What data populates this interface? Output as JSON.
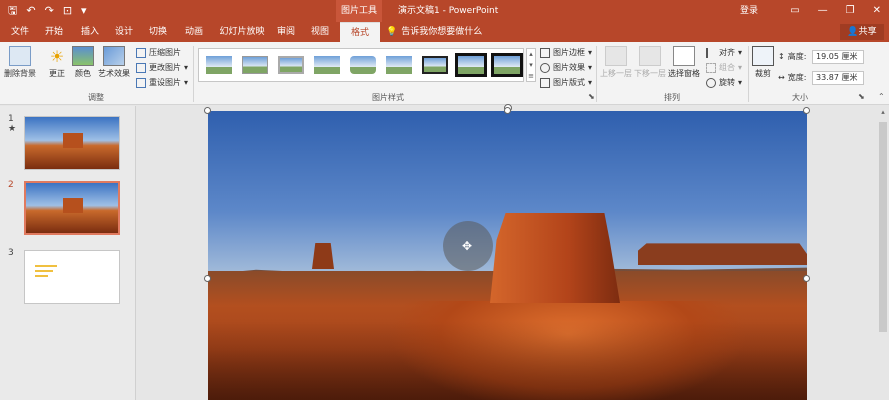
{
  "titlebar": {
    "qat_icons": [
      "save-icon",
      "undo-icon",
      "redo-icon",
      "start-from-beginning-icon",
      "customize-icon"
    ],
    "picture_tools": "图片工具",
    "doc_title": "演示文稿1 - PowerPoint",
    "login": "登录",
    "window_controls": [
      "▭",
      "—",
      "❐",
      "✕"
    ]
  },
  "tabs": {
    "file": "文件",
    "home": "开始",
    "insert": "插入",
    "design": "设计",
    "transitions": "切换",
    "animations": "动画",
    "slideshow": "幻灯片放映",
    "review": "审阅",
    "view": "视图",
    "format": "格式",
    "tellme": "告诉我你想要做什么",
    "share": "共享"
  },
  "ribbon": {
    "remove_bg": "删除背景",
    "corrections": "更正",
    "color": "颜色",
    "artistic": "艺术效果",
    "compress": "压缩图片",
    "change": "更改图片",
    "reset": "重设图片",
    "group_adjust": "调整",
    "picture_border": "图片边框",
    "picture_effects": "图片效果",
    "picture_layout": "图片版式",
    "group_styles": "图片样式",
    "bring_forward": "上移一层",
    "send_backward": "下移一层",
    "selection_pane": "选择窗格",
    "align": "对齐",
    "group": "组合",
    "rotate": "旋转",
    "group_arrange": "排列",
    "crop": "裁剪",
    "height_label": "高度:",
    "height_value": "19.05 厘米",
    "width_label": "宽度:",
    "width_value": "33.87 厘米",
    "group_size": "大小"
  },
  "slides": [
    {
      "number": "1",
      "marker": "★"
    },
    {
      "number": "2"
    },
    {
      "number": "3"
    }
  ],
  "colors": {
    "accent": "#b7472a",
    "ribbon_bg": "#f3f3f3"
  }
}
